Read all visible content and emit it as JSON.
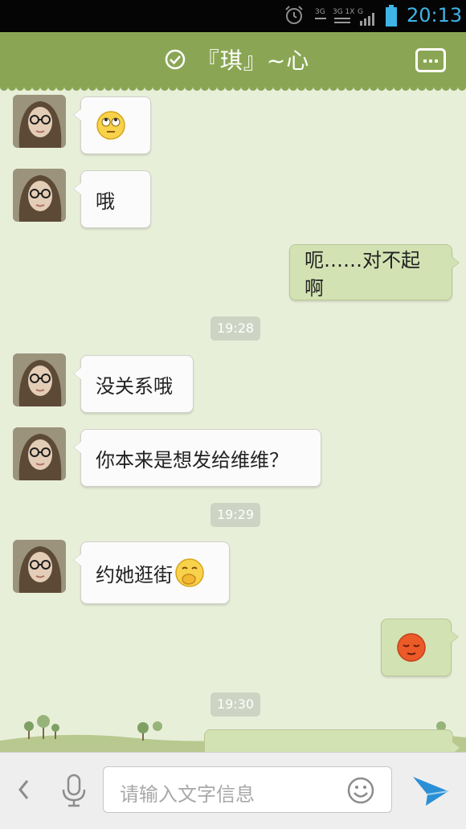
{
  "status_bar": {
    "network_label_1": "3G",
    "network_label_2": "3G 1X",
    "network_label_3": "G",
    "time": "20:13"
  },
  "header": {
    "title": "『琪』~心"
  },
  "messages": [
    {
      "side": "left",
      "type": "emoji",
      "emoji": "rolling-eyes-emoji"
    },
    {
      "side": "left",
      "type": "text",
      "text": "哦"
    },
    {
      "side": "right",
      "type": "text",
      "text": "呃……对不起啊"
    },
    {
      "type": "timestamp",
      "text": "19:28"
    },
    {
      "side": "left",
      "type": "text",
      "text": "没关系哦"
    },
    {
      "side": "left",
      "type": "text",
      "text": "你本来是想发给维维？"
    },
    {
      "type": "timestamp",
      "text": "19:29"
    },
    {
      "side": "left",
      "type": "text",
      "text": "约她逛街",
      "emoji": "giggle-emoji"
    },
    {
      "side": "right",
      "type": "emoji",
      "emoji": "embarrassed-emoji"
    },
    {
      "type": "timestamp",
      "text": "19:30"
    }
  ],
  "input_bar": {
    "placeholder": "请输入文字信息"
  },
  "colors": {
    "header": "#8aa654",
    "chat_bg": "#e8efd9",
    "outgoing_bubble": "#d3e2b3",
    "incoming_bubble": "#fbfbfb",
    "status_accent": "#3fb4e6",
    "send_icon": "#2b8fd6"
  }
}
